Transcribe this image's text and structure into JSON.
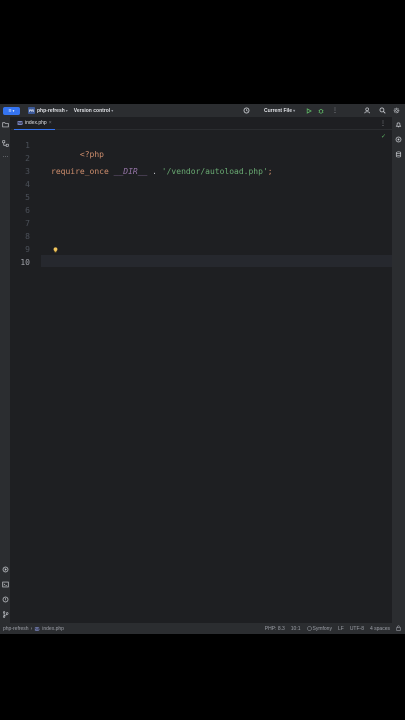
{
  "titlebar": {
    "project_badge": "PR",
    "project_name": "php-refresh",
    "vcs_label": "Version control",
    "run_config": "Current File"
  },
  "tab": {
    "file_icon": "PHP",
    "label": "index.php"
  },
  "editor": {
    "line_numbers": [
      "1",
      "2",
      "3",
      "4",
      "5",
      "6",
      "7",
      "8",
      "9",
      "10"
    ],
    "current_line": "10",
    "code": {
      "line1": "<?php",
      "line3_fn": "require_once",
      "line3_const": "__DIR__",
      "line3_op": " . ",
      "line3_str": "'/vendor/autoload.php'",
      "line3_end": ";"
    }
  },
  "statusbar": {
    "crumb_project": "php-refresh",
    "crumb_file": "index.php",
    "php_version": "PHP: 8.3",
    "cursor_pos": "10:1",
    "framework": "Symfony",
    "line_ending": "LF",
    "encoding": "UTF-8",
    "indent": "4 spaces"
  },
  "colors": {
    "accent": "#3574f0",
    "background": "#1e1f22",
    "panel": "#2b2d30",
    "keyword": "#cf8e6d",
    "string": "#6aab73",
    "constant": "#9876aa"
  },
  "icons": {
    "titlebar": [
      "hamburger-menu-icon",
      "chevron-down-icon",
      "history-icon",
      "run-icon",
      "debug-icon",
      "more-vertical-icon",
      "add-user-icon",
      "search-icon",
      "settings-gear-icon"
    ],
    "left_strip": [
      "project-folder-icon",
      "structure-icon",
      "more-horizontal-icon",
      "services-icon",
      "terminal-icon",
      "problems-icon",
      "git-icon"
    ],
    "right_strip": [
      "notifications-bell-icon",
      "ai-assistant-icon",
      "database-icon"
    ]
  }
}
